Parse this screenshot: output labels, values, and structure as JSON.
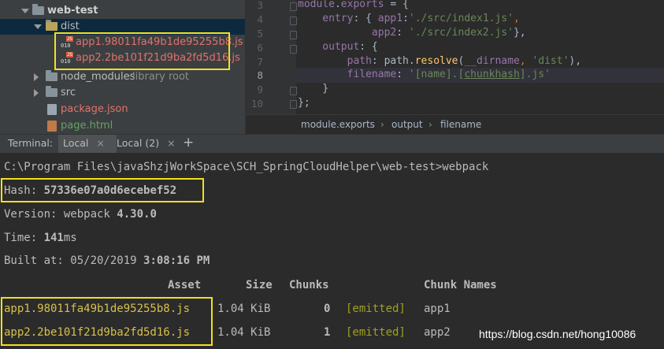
{
  "project_tree": {
    "root_label": "web-test",
    "dist_label": "dist",
    "files": [
      {
        "name": "app1.98011fa49b1de95255b8.js"
      },
      {
        "name": "app2.2be101f21d9ba2fd5d16.js"
      }
    ],
    "node_modules_label": "node_modules",
    "library_root_label": "library root",
    "src_label": "src",
    "package_json_label": "package.json",
    "page_html_label": "page.html",
    "js_icon_tag": "JS",
    "js_icon_bits": "010"
  },
  "editor": {
    "line_numbers": [
      "3",
      "4",
      "5",
      "6",
      "7",
      "8",
      "9",
      "10"
    ],
    "code": {
      "l3": {
        "a": "module",
        "b": ".",
        "c": "exports",
        "d": " = {"
      },
      "l4": {
        "a": "    entry",
        "b": ": { ",
        "c": "app1",
        "d": ":",
        "e": "'./src/index1.js'",
        "f": ","
      },
      "l5": {
        "a": "            app2",
        "b": ": ",
        "c": "'./src/index2.js'",
        "d": "},"
      },
      "l6": {
        "a": "    output",
        "b": ": {"
      },
      "l7": {
        "a": "        path",
        "b": ": path.",
        "c": "resolve",
        "d": "(",
        "e": "__dirname",
        "f": ", ",
        "g": "'dist'",
        "h": "),"
      },
      "l8": {
        "a": "        filename",
        "b": ": ",
        "c": "'[name].[",
        "d": "chunkhash",
        "e": "].js'"
      },
      "l9": {
        "a": "    }"
      },
      "l10": {
        "a": "};"
      }
    },
    "breadcrumbs": [
      "module.exports",
      "output",
      "filename"
    ],
    "breadcrumb_sep": "›"
  },
  "terminal_tabs": {
    "title": "Terminal:",
    "tabs": [
      {
        "label": "Local",
        "close": "×"
      },
      {
        "label": "Local (2)",
        "close": "×"
      }
    ],
    "add_label": "+"
  },
  "terminal": {
    "prompt": "C:\\Program Files\\javaShzjWorkSpace\\SCH_SpringCloudHelper\\web-test>webpack",
    "hash_label": "Hash: ",
    "hash_value": "57336e07a0d6ecebef52",
    "version_label": "Version: webpack ",
    "version_value": "4.30.0",
    "time_label": "Time: ",
    "time_value": "141",
    "time_unit": "ms",
    "built_label": "Built at: 05/20/2019 ",
    "built_time": "3:08:16 PM",
    "headers": {
      "asset": "Asset",
      "size": "Size",
      "chunks": "Chunks",
      "chunk_names": "Chunk Names"
    },
    "rows": [
      {
        "asset": "app1.98011fa49b1de95255b8.js",
        "size": "1.04 KiB",
        "chunk": "0",
        "status": "[emitted]",
        "name": "app1"
      },
      {
        "asset": "app2.2be101f21d9ba2fd5d16.js",
        "size": "1.04 KiB",
        "chunk": "1",
        "status": "[emitted]",
        "name": "app2"
      }
    ],
    "watermark": "https://blog.csdn.net/hong10086"
  },
  "colors": {
    "highlight_box": "#f0e020",
    "selection": "#0d293e"
  }
}
